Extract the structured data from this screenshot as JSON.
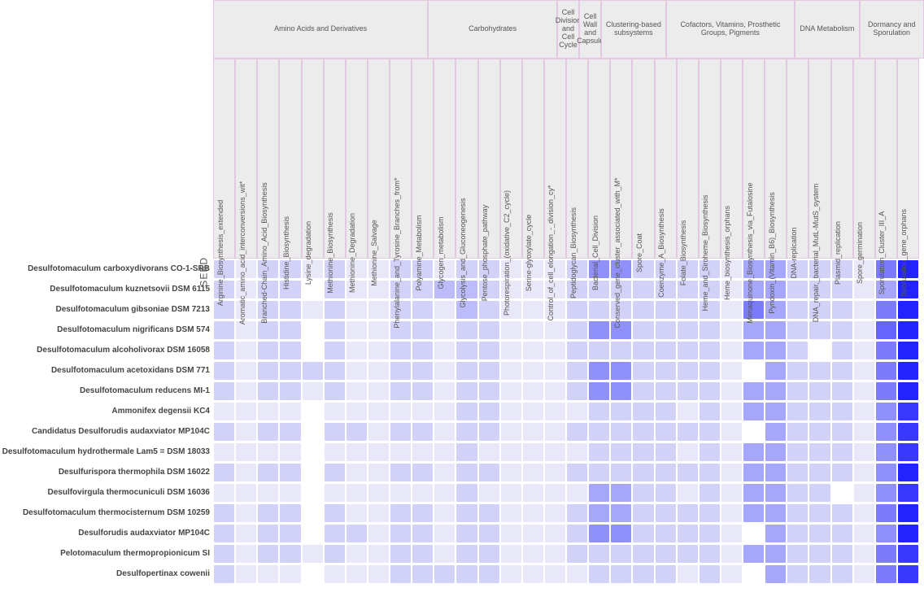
{
  "seed_label": "SEED",
  "groups": [
    {
      "name": "Amino Acids and Derivatives",
      "span": 10
    },
    {
      "name": "Carbohydrates",
      "span": 6
    },
    {
      "name": "Cell Division and Cell Cycle",
      "span": 1
    },
    {
      "name": "Cell Wall and Capsule",
      "span": 1
    },
    {
      "name": "Clustering-based subsystems",
      "span": 3
    },
    {
      "name": "Cofactors, Vitamins, Prosthetic Groups, Pigments",
      "span": 6
    },
    {
      "name": "DNA Metabolism",
      "span": 3
    },
    {
      "name": "Dormancy and Sporulation",
      "span": 3
    }
  ],
  "columns": [
    "Arginine_Biosynthesis_extended",
    "Aromatic_amino_acid_interconversions_wit*",
    "Branched-Chain_Amino_Acid_Biosynthesis",
    "Histidine_Biosynthesis",
    "Lysine_degradation",
    "Methionine_Biosynthesis",
    "Methionine_Degradation",
    "Methionine_Salvage",
    "Phenylalanine_and_Tyrosine_Branches_from*",
    "Polyamine_Metabolism",
    "Glycogen_metabolism",
    "Glycolysis_and_Gluconeogenesis",
    "Pentose_phosphate_pathway",
    "Photorespiration_(oxidative_C2_cycle)",
    "Serine-glyoxylate_cycle",
    "Control_of_cell_elongation_-_division_cy*",
    "Peptidoglycan_Biosynthesis",
    "Bacterial_Cell_Division",
    "Conserved_gene_cluster_associated_with_M*",
    "Spore_Coat",
    "Coenzyme_A_Biosynthesis",
    "Folate_Biosynthesis",
    "Heme_and_Siroheme_Biosynthesis",
    "Heme_biosynthesis_orphans",
    "Menaquinone_Biosynthesis_via_Futalosine",
    "Pyridoxin_(Vitamin_B6)_Biosynthesis",
    "DNA-replication",
    "DNA_repair,_bacterial_MutL-MutS_system",
    "Plasmid_replication",
    "Spore_germination",
    "Sporulation_Cluster_III_A",
    "Sporulation_gene_orphans"
  ],
  "rows": [
    "Desulfotomaculum carboxydivorans CO-1-SRB",
    "Desulfotomaculum kuznetsovii DSM 6115",
    "Desulfotomaculum gibsoniae DSM 7213",
    "Desulfotomaculum nigrificans DSM 574",
    "Desulfotomaculum alcoholivorax DSM 16058",
    "Desulfotomaculum acetoxidans DSM 771",
    "Desulfotomaculum reducens MI-1",
    "Ammonifex degensii KC4",
    "Candidatus Desulforudis audaxviator MP104C",
    "Desulfotomaculum hydrothermale Lam5 = DSM 18033",
    "Desulfurispora thermophila DSM 16022",
    "Desulfovirgula thermocuniculi DSM 16036",
    "Desulfotomaculum thermocisternum DSM 10259",
    "Desulforudis audaxviator MP104C",
    "Pelotomaculum thermopropionicum SI",
    "Desulfopertinax cowenii"
  ],
  "chart_data": {
    "type": "heatmap",
    "title": "",
    "xlabel": "",
    "ylabel": "",
    "value_range": [
      0,
      10
    ],
    "legend": "values are ordinal intensity 0=absent, 1-10 increasing presence (darker blue = higher)",
    "values": [
      [
        2,
        1,
        2,
        2,
        1,
        2,
        1,
        1,
        2,
        2,
        1,
        2,
        2,
        1,
        1,
        1,
        2,
        5,
        5,
        2,
        2,
        2,
        2,
        1,
        4,
        4,
        2,
        2,
        2,
        1,
        6,
        10
      ],
      [
        2,
        1,
        2,
        2,
        0,
        2,
        1,
        1,
        2,
        2,
        3,
        3,
        2,
        1,
        1,
        1,
        2,
        2,
        2,
        2,
        2,
        2,
        2,
        1,
        4,
        4,
        2,
        2,
        2,
        1,
        4,
        10
      ],
      [
        2,
        1,
        2,
        2,
        1,
        2,
        1,
        1,
        2,
        2,
        1,
        3,
        2,
        1,
        1,
        1,
        2,
        2,
        2,
        2,
        2,
        2,
        2,
        1,
        6,
        4,
        2,
        2,
        2,
        1,
        6,
        10
      ],
      [
        2,
        1,
        2,
        2,
        0,
        2,
        1,
        1,
        2,
        2,
        1,
        2,
        2,
        1,
        1,
        1,
        2,
        5,
        5,
        2,
        2,
        2,
        2,
        1,
        4,
        4,
        2,
        2,
        2,
        1,
        7,
        10
      ],
      [
        2,
        1,
        2,
        2,
        0,
        2,
        1,
        1,
        2,
        2,
        1,
        2,
        2,
        1,
        1,
        1,
        2,
        2,
        2,
        2,
        2,
        2,
        2,
        1,
        4,
        4,
        2,
        0,
        2,
        1,
        6,
        10
      ],
      [
        2,
        1,
        2,
        2,
        2,
        2,
        1,
        1,
        2,
        2,
        1,
        2,
        2,
        1,
        1,
        1,
        2,
        5,
        5,
        2,
        2,
        2,
        2,
        1,
        0,
        4,
        2,
        2,
        2,
        1,
        6,
        10
      ],
      [
        2,
        1,
        2,
        2,
        1,
        2,
        1,
        1,
        2,
        2,
        1,
        2,
        2,
        1,
        1,
        1,
        2,
        5,
        5,
        2,
        2,
        2,
        2,
        1,
        4,
        4,
        2,
        2,
        2,
        1,
        6,
        10
      ],
      [
        1,
        1,
        1,
        1,
        0,
        1,
        1,
        1,
        1,
        1,
        1,
        2,
        2,
        1,
        1,
        1,
        1,
        2,
        2,
        2,
        2,
        1,
        2,
        1,
        4,
        4,
        2,
        2,
        2,
        1,
        5,
        9
      ],
      [
        2,
        1,
        2,
        2,
        0,
        2,
        2,
        1,
        2,
        2,
        1,
        2,
        2,
        1,
        1,
        1,
        2,
        2,
        2,
        2,
        2,
        2,
        2,
        1,
        0,
        4,
        2,
        2,
        2,
        1,
        5,
        9
      ],
      [
        1,
        1,
        1,
        1,
        0,
        1,
        1,
        1,
        1,
        1,
        1,
        2,
        1,
        1,
        1,
        1,
        1,
        2,
        2,
        2,
        2,
        1,
        2,
        1,
        4,
        4,
        2,
        2,
        2,
        1,
        5,
        9
      ],
      [
        2,
        1,
        2,
        2,
        0,
        2,
        1,
        1,
        2,
        2,
        1,
        2,
        2,
        1,
        1,
        1,
        2,
        2,
        2,
        2,
        2,
        2,
        2,
        1,
        4,
        4,
        2,
        2,
        2,
        1,
        5,
        10
      ],
      [
        1,
        1,
        1,
        1,
        0,
        1,
        1,
        1,
        1,
        1,
        1,
        2,
        1,
        1,
        1,
        1,
        1,
        4,
        4,
        2,
        2,
        1,
        2,
        1,
        4,
        4,
        2,
        2,
        0,
        1,
        5,
        9
      ],
      [
        2,
        1,
        2,
        2,
        0,
        2,
        1,
        1,
        2,
        2,
        1,
        2,
        2,
        1,
        1,
        1,
        2,
        4,
        4,
        2,
        2,
        2,
        2,
        1,
        4,
        4,
        2,
        2,
        2,
        1,
        6,
        10
      ],
      [
        2,
        1,
        2,
        2,
        0,
        2,
        2,
        1,
        2,
        2,
        1,
        2,
        2,
        1,
        1,
        1,
        2,
        5,
        5,
        2,
        2,
        2,
        2,
        1,
        0,
        4,
        2,
        2,
        2,
        1,
        5,
        10
      ],
      [
        2,
        1,
        2,
        2,
        1,
        2,
        1,
        1,
        2,
        2,
        1,
        2,
        2,
        1,
        1,
        1,
        2,
        2,
        2,
        2,
        2,
        2,
        2,
        1,
        4,
        4,
        2,
        2,
        2,
        1,
        6,
        9
      ],
      [
        2,
        1,
        1,
        1,
        0,
        1,
        1,
        1,
        2,
        2,
        2,
        2,
        2,
        1,
        1,
        1,
        1,
        2,
        2,
        2,
        2,
        1,
        2,
        1,
        0,
        4,
        2,
        2,
        2,
        1,
        6,
        9
      ]
    ]
  }
}
